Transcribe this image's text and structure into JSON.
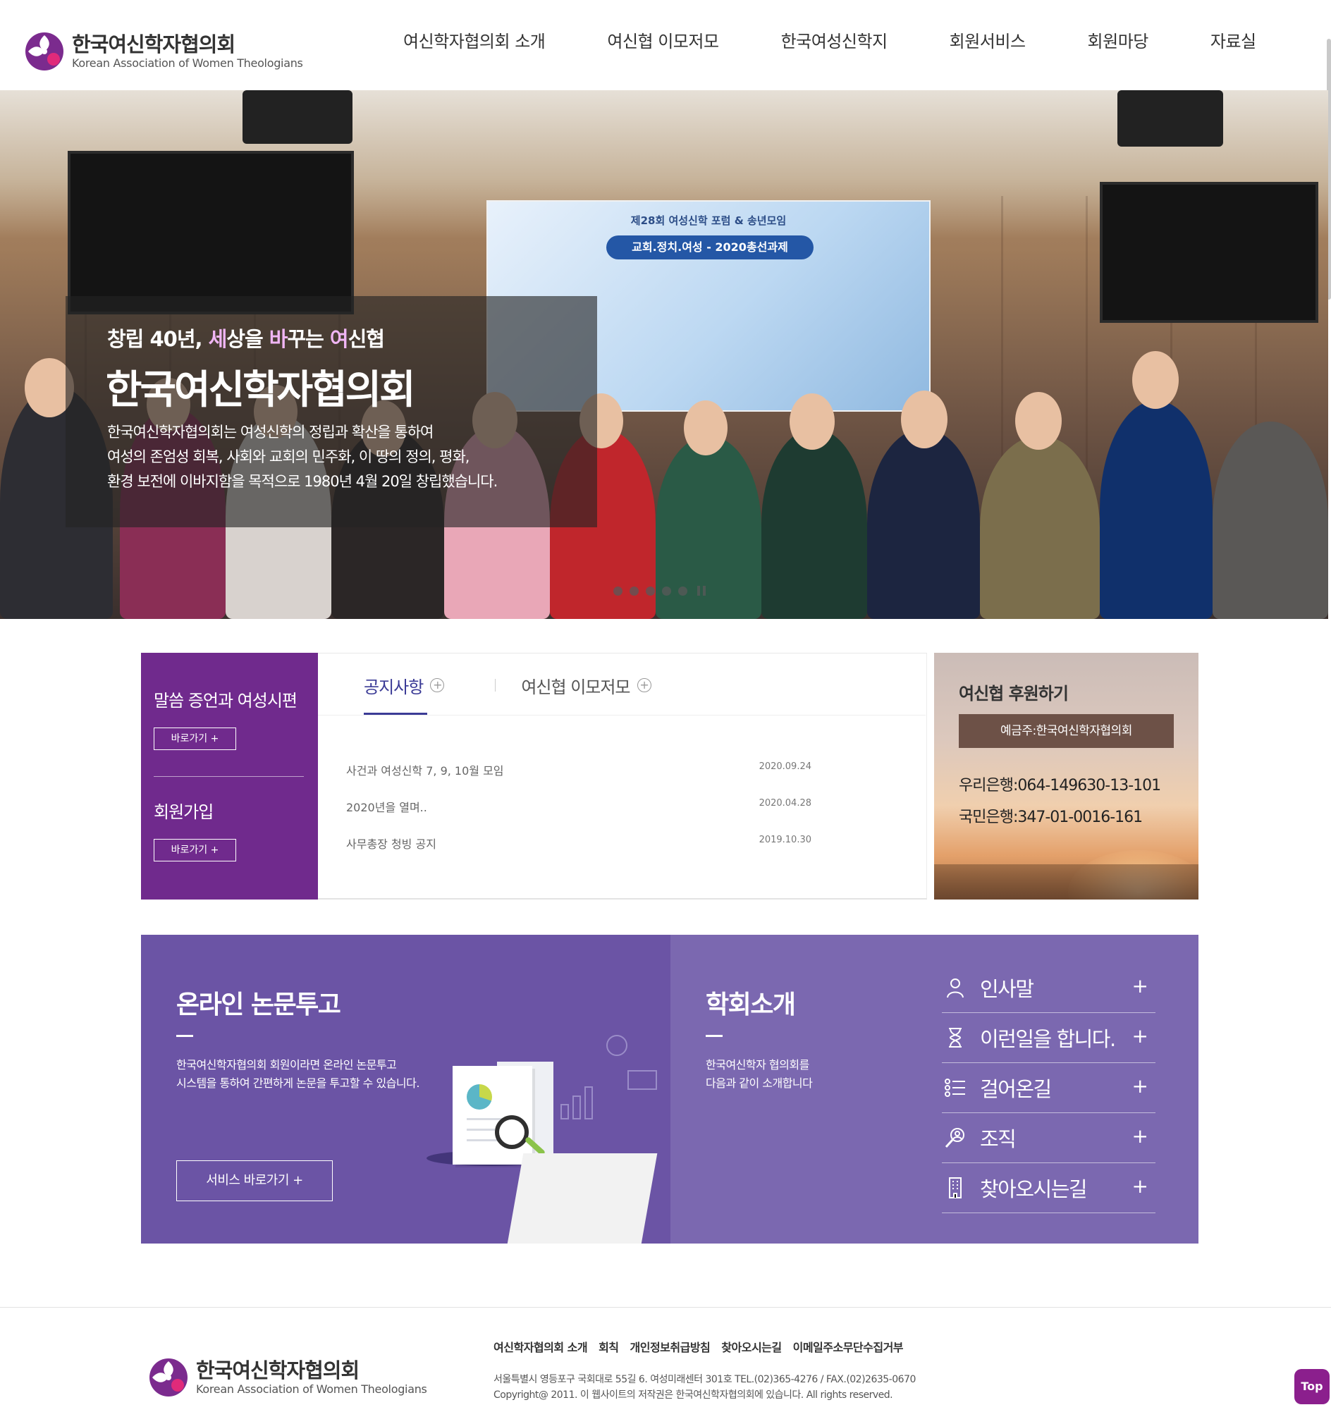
{
  "header": {
    "logo_ko": "한국여신학자협의회",
    "logo_en": "Korean Association of Women Theologians",
    "nav": [
      "여신학자협의회 소개",
      "여신협 이모저모",
      "한국여성신학지",
      "회원서비스",
      "회원마당",
      "자료실"
    ]
  },
  "hero": {
    "subtitle_parts": [
      "창립 40년, ",
      "세",
      "상을 ",
      "바",
      "꾸는 ",
      "여",
      "신협"
    ],
    "title": "한국여신학자협의회",
    "description": "한국여신학자협의회는 여성신학의 정립과 확산을 통하여\n여성의 존엄성 회복, 사회와 교회의 민주화, 이 땅의 정의, 평화,\n환경 보전에 이바지함을 목적으로 1980년 4월 20일 창립했습니다.",
    "banner_title": "제28회 여성신학 포럼 & 송년모임",
    "banner_pill": "교회.정치.여성 - 2020총선과제",
    "slide_count": 6
  },
  "quick": {
    "item1_title": "말씀 증언과 여성시편",
    "item1_button": "바로가기 +",
    "item2_title": "회원가입",
    "item2_button": "바로가기 +"
  },
  "notice": {
    "tabs": [
      "공지사항",
      "여신협 이모저모"
    ],
    "rows": [
      {
        "title": "사건과 여성신학 7, 9, 10월 모임",
        "date": "2020.09.24"
      },
      {
        "title": "2020년을 열며..",
        "date": "2020.04.28"
      },
      {
        "title": "사무총장 청빙 공지",
        "date": "2019.10.30"
      }
    ]
  },
  "support": {
    "title": "여신협 후원하기",
    "account_holder": "예금주:한국여신학자협의회",
    "bank1": "우리은행:064-149630-13-101",
    "bank2": "국민은행:347-01-0016-161"
  },
  "online": {
    "title": "온라인 논문투고",
    "description": "한국여신학자협의회 회원이라면 온라인 논문투고\n시스템을 통하여 간편하게 논문을 투고할 수 있습니다.",
    "button": "서비스 바로가기 +"
  },
  "society": {
    "title": "학회소개",
    "description": "한국여신학자 협의회를\n다음과 같이 소개합니다",
    "items": [
      {
        "label": "인사말",
        "icon": "person-icon"
      },
      {
        "label": "이런일을 합니다.",
        "icon": "hourglass-icon"
      },
      {
        "label": "걸어온길",
        "icon": "list-icon"
      },
      {
        "label": "조직",
        "icon": "organization-icon"
      },
      {
        "label": "찾아오시는길",
        "icon": "building-icon"
      }
    ],
    "plus": "+"
  },
  "footer": {
    "links": [
      "여신학자협의회 소개",
      "회칙",
      "개인정보취급방침",
      "찾아오시는길",
      "이메일주소무단수집거부"
    ],
    "address": "서울특별시 영등포구 국회대로 55길 6. 여성미래센터 301호 TEL.(02)365-4276 / FAX.(02)2635-0670",
    "copyright": "Copyright@ 2011. 이 웹사이트의 저작권은 한국여신학자협의회에 있습니다. All rights reserved.",
    "top_button": "Top"
  },
  "colors": {
    "brand_purple": "#702a8d",
    "online_bg": "#6b54a5",
    "society_bg": "#7b68b0",
    "tab_active": "#3b3b96",
    "support_bar": "#6d5147"
  }
}
